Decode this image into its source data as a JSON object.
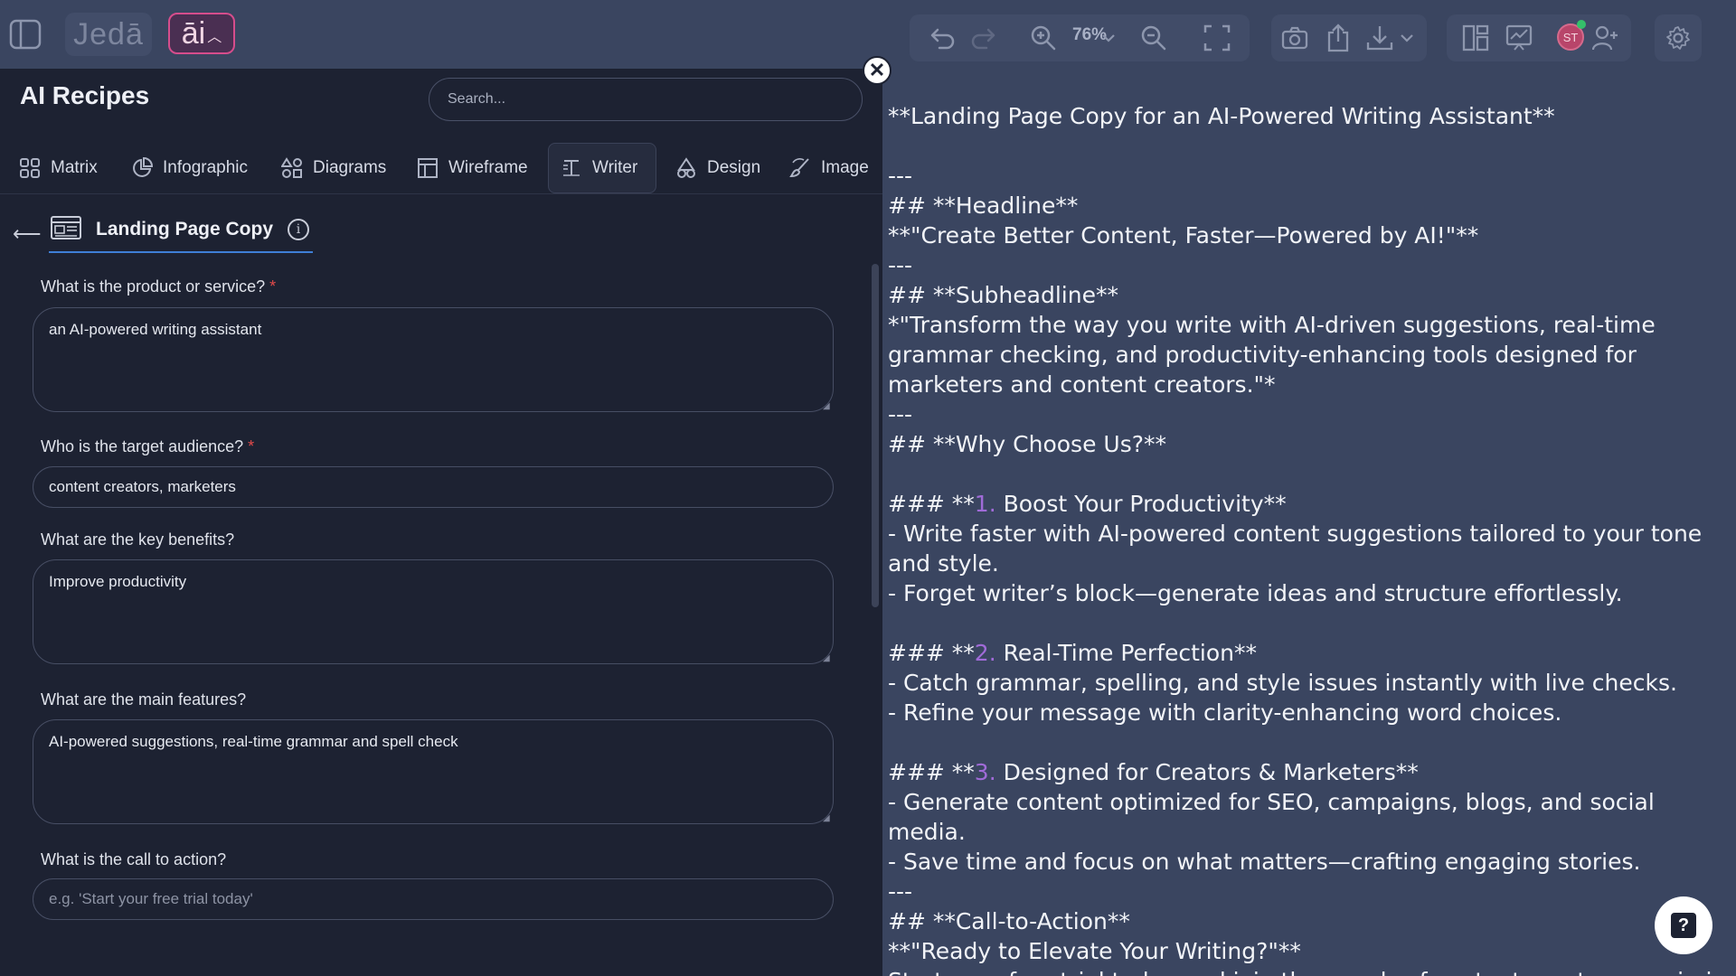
{
  "app": {
    "logo": "Jedā",
    "ai_button_label": "āi",
    "zoom": "76%",
    "avatar_initials": "ST"
  },
  "panel": {
    "title": "AI Recipes",
    "search_placeholder": "Search...",
    "tabs": [
      {
        "label": "Matrix",
        "icon": "grid-icon"
      },
      {
        "label": "Infographic",
        "icon": "pie-chart-icon"
      },
      {
        "label": "Diagrams",
        "icon": "shapes-icon"
      },
      {
        "label": "Wireframe",
        "icon": "wireframe-icon"
      },
      {
        "label": "Writer",
        "icon": "text-icon",
        "active": true
      },
      {
        "label": "Design",
        "icon": "design-icon"
      },
      {
        "label": "Image",
        "icon": "brush-icon"
      }
    ],
    "recipe_title": "Landing Page Copy",
    "form": {
      "product_label": "What is the product or service?",
      "product_value": "an AI-powered writing assistant",
      "audience_label": "Who is the target audience?",
      "audience_value": "content creators, marketers",
      "benefits_label": "What are the key benefits?",
      "benefits_value": "Improve productivity",
      "features_label": "What are the main features?",
      "features_value": "AI-powered suggestions, real-time grammar and spell check",
      "cta_label": "What is the call to action?",
      "cta_placeholder": "e.g. 'Start your free trial today'",
      "required_mark": "*"
    }
  },
  "output": {
    "title": "**Landing Page Copy for an AI-Powered Writing Assistant**",
    "sep1": "---",
    "headline_h": "## **Headline**",
    "headline": "**\"Create Better Content, Faster—Powered by AI!\"**",
    "sep2": "---",
    "subheadline_h": "## **Subheadline**",
    "subheadline": "*\"Transform the way you write with AI-driven suggestions, real-time grammar checking, and productivity-enhancing tools designed for marketers and content creators.\"*",
    "sep3": "---",
    "why_h": "## **Why Choose Us?**",
    "s1_prefix": "### **",
    "s1_num": "1.",
    "s1_title": " Boost Your Productivity**",
    "s1_b1": "- Write faster with AI-powered content suggestions tailored to your tone and style.",
    "s1_b2": "- Forget writer’s block—generate ideas and structure effortlessly.",
    "s2_prefix": "### **",
    "s2_num": "2.",
    "s2_title": " Real-Time Perfection**",
    "s2_b1": "- Catch grammar, spelling, and style issues instantly with live checks.",
    "s2_b2": "- Refine your message with clarity-enhancing word choices.",
    "s3_prefix": "### **",
    "s3_num": "3.",
    "s3_title": " Designed for Creators & Marketers**",
    "s3_b1": "- Generate content optimized for SEO, campaigns, blogs, and social media.",
    "s3_b2": "- Save time and focus on what matters—crafting engaging stories.",
    "sep4": "---",
    "cta_h": "## **Call-to-Action**",
    "cta": "**\"Ready to Elevate Your Writing?\"**",
    "cta_body": "Start your free trial today and join thousands of content creators maximizing"
  },
  "colors": {
    "background": "#3a4560",
    "panel": "#1d2232",
    "accent_pink": "#d64d8c",
    "accent_blue": "#3f7fd6",
    "required": "#e24a4a",
    "list_number": "#a06bd8"
  }
}
